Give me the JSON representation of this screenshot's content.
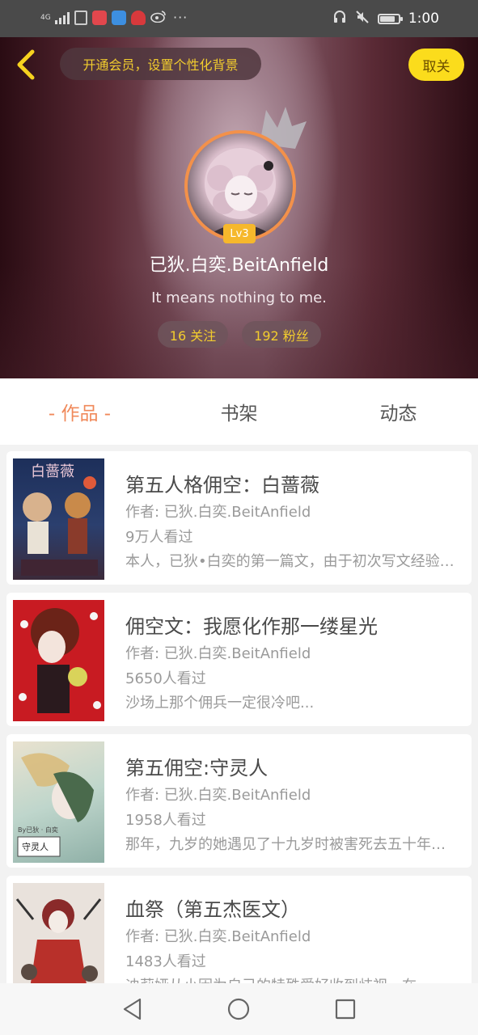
{
  "status_bar": {
    "network": "4G",
    "time": "1:00",
    "more": "···",
    "battery_level": 0.8
  },
  "header": {
    "vip_prompt": "开通会员，设置个性化背景",
    "unfollow_label": "取关",
    "level": "Lv3",
    "username": "已狄.白奕.BeitAnfield",
    "bio": "It means nothing to me.",
    "following": "16 关注",
    "followers": "192 粉丝"
  },
  "tabs": [
    {
      "label": "- 作品 -",
      "active": true
    },
    {
      "label": "书架",
      "active": false
    },
    {
      "label": "动态",
      "active": false
    }
  ],
  "works": [
    {
      "title": "第五人格佣空：白蔷薇",
      "author": "作者: 已狄.白奕.BeitAnfield",
      "views": "9万人看过",
      "description": "本人，已狄•白奕的第一篇文，由于初次写文经验不足还望多多包涵"
    },
    {
      "title": "佣空文：我愿化作那一缕星光",
      "author": "作者: 已狄.白奕.BeitAnfield",
      "views": "5650人看过",
      "description": "沙场上那个佣兵一定很冷吧..."
    },
    {
      "title": "第五佣空:守灵人",
      "author": "作者: 已狄.白奕.BeitAnfield",
      "views": "1958人看过",
      "description": "那年，九岁的她遇见了十九岁时被害死去五十年的他"
    },
    {
      "title": "血祭（第五杰医文）",
      "author": "作者: 已狄.白奕.BeitAnfield",
      "views": "1483人看过",
      "description": "迪莉娅从小因为自己的特殊爱好收到歧视，在..."
    }
  ],
  "covers": {
    "cover1_text": "白蔷薇",
    "cover3_text": "守灵人",
    "cover3_small": "By已狄 · 白奕"
  },
  "colors": {
    "accent": "#f0895a",
    "gold": "#f2cc2e",
    "unfollow_bg": "#fbdc1c",
    "level_bg": "#f6b82c"
  }
}
